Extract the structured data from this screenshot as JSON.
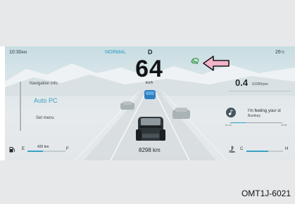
{
  "status_bar": {
    "time": "10:30",
    "time_suffix": "AM",
    "drive_mode": "NORMAL",
    "gear": "D",
    "outside_temp": "26",
    "temp_unit": "°C"
  },
  "speedometer": {
    "speed": "64",
    "unit": "km/h"
  },
  "indicators": {
    "eco_icon": "eco-car-icon",
    "callout": "pointer-arrow"
  },
  "left_panel": {
    "title": "Navigation info",
    "selected": "Auto PC",
    "menu": "Set menu"
  },
  "right_panel": {
    "consumption_value": "0.4",
    "consumption_unit": "ℓ/1000rpm",
    "media": {
      "icon": "music-icon",
      "title": "I'm feeling your st",
      "artist": "Bumkey",
      "time_elapsed": "01:13",
      "time_total": "03:51"
    }
  },
  "odometer": "8298 km",
  "fuel": {
    "empty_label": "E",
    "full_label": "F",
    "range": "420 km",
    "level_fraction": 0.4
  },
  "coolant": {
    "cold_label": "C",
    "hot_label": "H",
    "level_fraction": 0.6
  },
  "caption": "OMT1J-6021",
  "colors": {
    "accent": "#2e9bc4",
    "arrow_fill": "#f3b4c9",
    "arrow_stroke": "#1a1a1a",
    "eco_green": "#3a9a4a"
  }
}
